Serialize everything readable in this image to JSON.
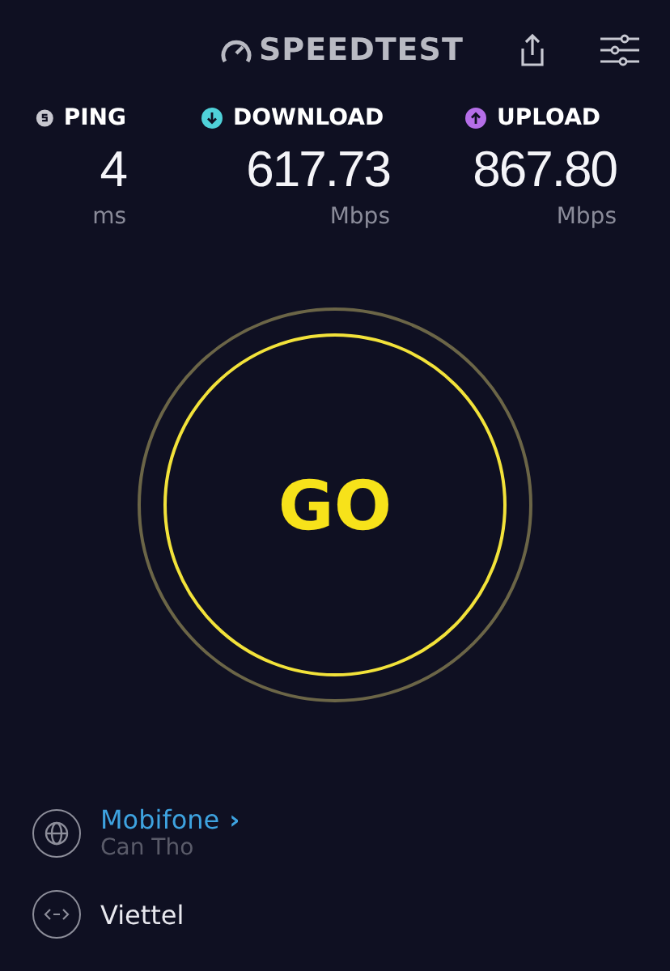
{
  "header": {
    "logo": "SPEEDTEST"
  },
  "metrics": [
    {
      "kind": "ping",
      "label": "PING",
      "value": "4",
      "unit": "ms",
      "color": "#c8c8d0"
    },
    {
      "kind": "download",
      "label": "DOWNLOAD",
      "value": "617.73",
      "unit": "Mbps",
      "color": "#4fd1d9"
    },
    {
      "kind": "upload",
      "label": "UPLOAD",
      "value": "867.80",
      "unit": "Mbps",
      "color": "#b56ee8"
    }
  ],
  "go_button": "GO",
  "provider": {
    "name": "Mobifone",
    "location": "Can Tho",
    "chevron": "›"
  },
  "server": {
    "name": "Viettel"
  }
}
